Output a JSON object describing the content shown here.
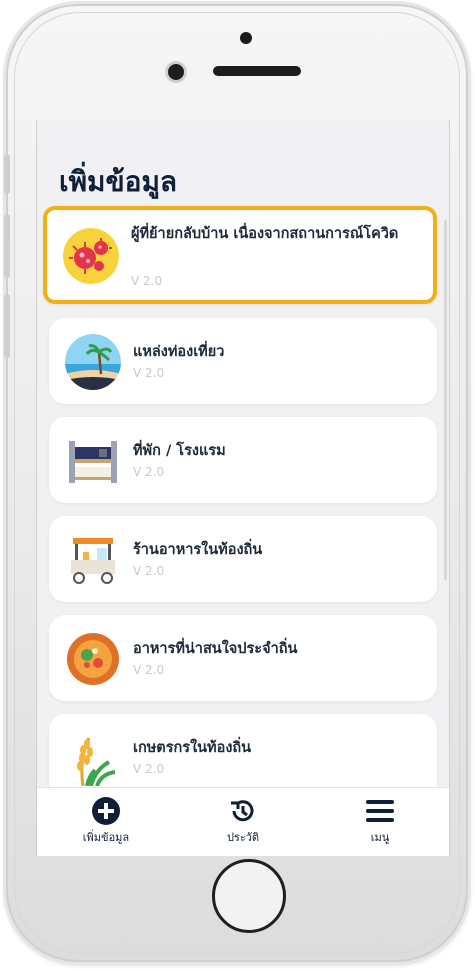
{
  "page": {
    "title": "เพิ่มข้อมูล"
  },
  "items": [
    {
      "title": "ผู้ที่ย้ายกลับบ้าน เนื่องจากสถานการณ์โควิด",
      "version": "V 2.0",
      "icon": "virus-icon",
      "highlighted": true
    },
    {
      "title": "แหล่งท่องเที่ยว",
      "version": "V 2.0",
      "icon": "beach-icon"
    },
    {
      "title": "ที่พัก / โรงแรม",
      "version": "V 2.0",
      "icon": "bed-icon"
    },
    {
      "title": "ร้านอาหารในท้องถิ่น",
      "version": "V 2.0",
      "icon": "food-cart-icon"
    },
    {
      "title": "อาหารที่น่าสนใจประจำถิ่น",
      "version": "V 2.0",
      "icon": "local-dish-icon"
    },
    {
      "title": "เกษตรกรในท้องถิ่น",
      "version": "V 2.0",
      "icon": "rice-plant-icon"
    }
  ],
  "nav": [
    {
      "label": "เพิ่มข้อมูล",
      "icon": "add-circle-icon",
      "active": true
    },
    {
      "label": "ประวัติ",
      "icon": "history-icon"
    },
    {
      "label": "เมนู",
      "icon": "menu-icon"
    }
  ],
  "colors": {
    "highlight": "#f0b016",
    "text": "#0f1f3a",
    "muted": "#c9c9c9"
  }
}
